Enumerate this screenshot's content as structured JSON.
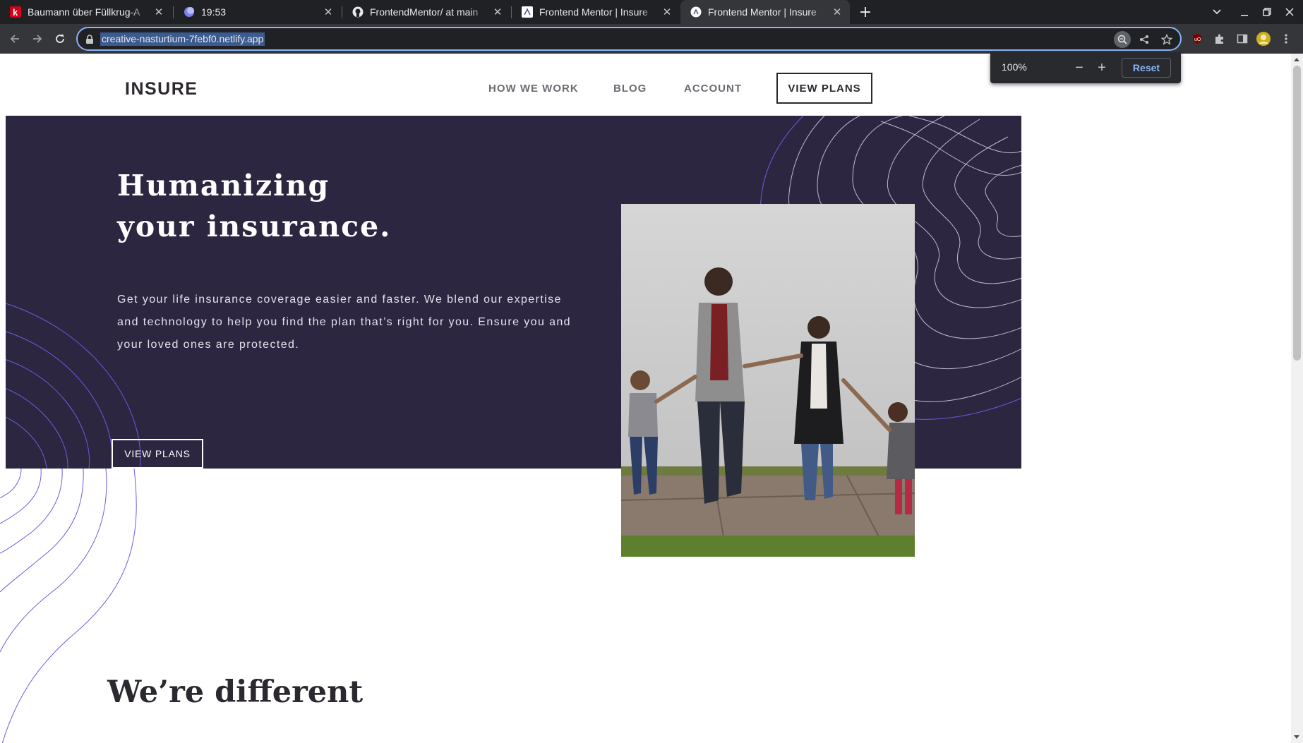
{
  "browser": {
    "tabs": [
      {
        "title": "Baumann über Füllkrug-A",
        "favicon": "kicker-k-icon",
        "active": false
      },
      {
        "title": "19:53",
        "favicon": "moon-icon",
        "active": false
      },
      {
        "title": "FrontendMentor/ at main",
        "favicon": "github-icon",
        "active": false
      },
      {
        "title": "Frontend Mentor | Insure",
        "favicon": "frontend-mentor-icon",
        "active": false
      },
      {
        "title": "Frontend Mentor | Insure",
        "favicon": "frontend-mentor-icon",
        "active": true
      }
    ],
    "url": "creative-nasturtium-7febf0.netlify.app",
    "zoom_popup": {
      "level": "100%",
      "minus": "−",
      "plus": "+",
      "reset_label": "Reset"
    },
    "accent": "#8ab4f8"
  },
  "site": {
    "logo": "INSURE",
    "nav": [
      "HOW WE WORK",
      "BLOG",
      "ACCOUNT"
    ],
    "nav_cta": "VIEW PLANS",
    "hero": {
      "title_line1": "Humanizing",
      "title_line2": "your insurance.",
      "text": "Get your life insurance coverage easier and faster. We blend our expertise and technology to help you find the plan that’s right for you. Ensure you and your loved ones are protected.",
      "cta": "VIEW PLANS"
    },
    "section_title": "We’re different",
    "colors": {
      "hero_bg": "#2c2640",
      "dark": "#2c2830",
      "curve": "#6b5ce0"
    }
  }
}
